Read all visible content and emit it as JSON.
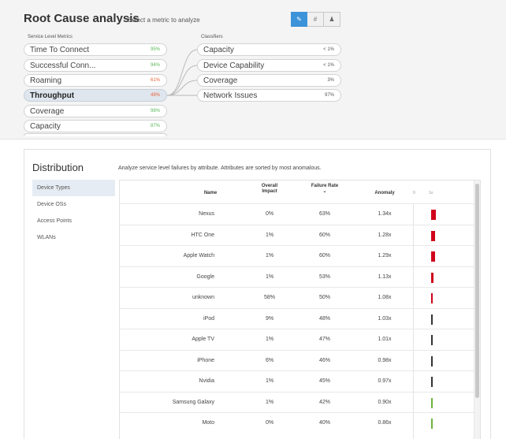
{
  "header": {
    "title": "Root Cause analysis",
    "subtitle": "Select a metric to analyze",
    "view_modes": [
      {
        "label": "✎",
        "icon": "chart-icon"
      },
      {
        "label": "#",
        "icon": "hash-icon"
      },
      {
        "label": "👤",
        "icon": "user-icon"
      }
    ]
  },
  "metrics": {
    "heading": "Service Level Metrics",
    "items": [
      {
        "label": "Time To Connect",
        "value": "95%",
        "color": "#5cb85c"
      },
      {
        "label": "Successful Conn...",
        "value": "94%",
        "color": "#5cb85c"
      },
      {
        "label": "Roaming",
        "value": "61%",
        "color": "#e8643c"
      },
      {
        "label": "Throughput",
        "value": "49%",
        "color": "#e8643c"
      },
      {
        "label": "Coverage",
        "value": "98%",
        "color": "#5cb85c"
      },
      {
        "label": "Capacity",
        "value": "87%",
        "color": "#5cb85c"
      }
    ]
  },
  "classifiers": {
    "heading": "Classifiers",
    "items": [
      {
        "label": "Capacity",
        "value": "< 1%"
      },
      {
        "label": "Device Capability",
        "value": "< 1%"
      },
      {
        "label": "Coverage",
        "value": "3%"
      },
      {
        "label": "Network Issues",
        "value": "97%"
      }
    ]
  },
  "distribution": {
    "title": "Distribution",
    "description": "Analyze service level failures by attribute. Attributes are sorted by most anomalous.",
    "nav": [
      "Device Types",
      "Device OSs",
      "Access Points",
      "WLANs"
    ],
    "columns": {
      "name": "Name",
      "impact": "Overall Impact",
      "rate": "Failure Rate",
      "sort_icon": "⌄",
      "anomaly": "Anomaly",
      "axis_zero": "0",
      "axis_one": "1x"
    },
    "rows": [
      {
        "name": "Nexus",
        "impact": "0%",
        "rate": "63%",
        "anomaly": "1.34x",
        "score": 1.34,
        "color": "#d0021b"
      },
      {
        "name": "HTC One",
        "impact": "1%",
        "rate": "60%",
        "anomaly": "1.28x",
        "score": 1.28,
        "color": "#d0021b"
      },
      {
        "name": "Apple Watch",
        "impact": "1%",
        "rate": "60%",
        "anomaly": "1.29x",
        "score": 1.29,
        "color": "#d0021b"
      },
      {
        "name": "Google",
        "impact": "1%",
        "rate": "53%",
        "anomaly": "1.13x",
        "score": 1.13,
        "color": "#d0021b"
      },
      {
        "name": "unknown",
        "impact": "58%",
        "rate": "50%",
        "anomaly": "1.08x",
        "score": 1.08,
        "color": "#d0021b"
      },
      {
        "name": "iPod",
        "impact": "9%",
        "rate": "48%",
        "anomaly": "1.03x",
        "score": 1.03,
        "color": "#333333"
      },
      {
        "name": "Apple TV",
        "impact": "1%",
        "rate": "47%",
        "anomaly": "1.01x",
        "score": 1.01,
        "color": "#333333"
      },
      {
        "name": "iPhone",
        "impact": "6%",
        "rate": "46%",
        "anomaly": "0.98x",
        "score": 0.98,
        "color": "#333333"
      },
      {
        "name": "Nvidia",
        "impact": "1%",
        "rate": "45%",
        "anomaly": "0.97x",
        "score": 0.97,
        "color": "#333333"
      },
      {
        "name": "Samsung Galaxy",
        "impact": "1%",
        "rate": "42%",
        "anomaly": "0.90x",
        "score": 0.9,
        "color": "#6db33f"
      },
      {
        "name": "Moto",
        "impact": "0%",
        "rate": "40%",
        "anomaly": "0.86x",
        "score": 0.86,
        "color": "#6db33f"
      }
    ]
  }
}
